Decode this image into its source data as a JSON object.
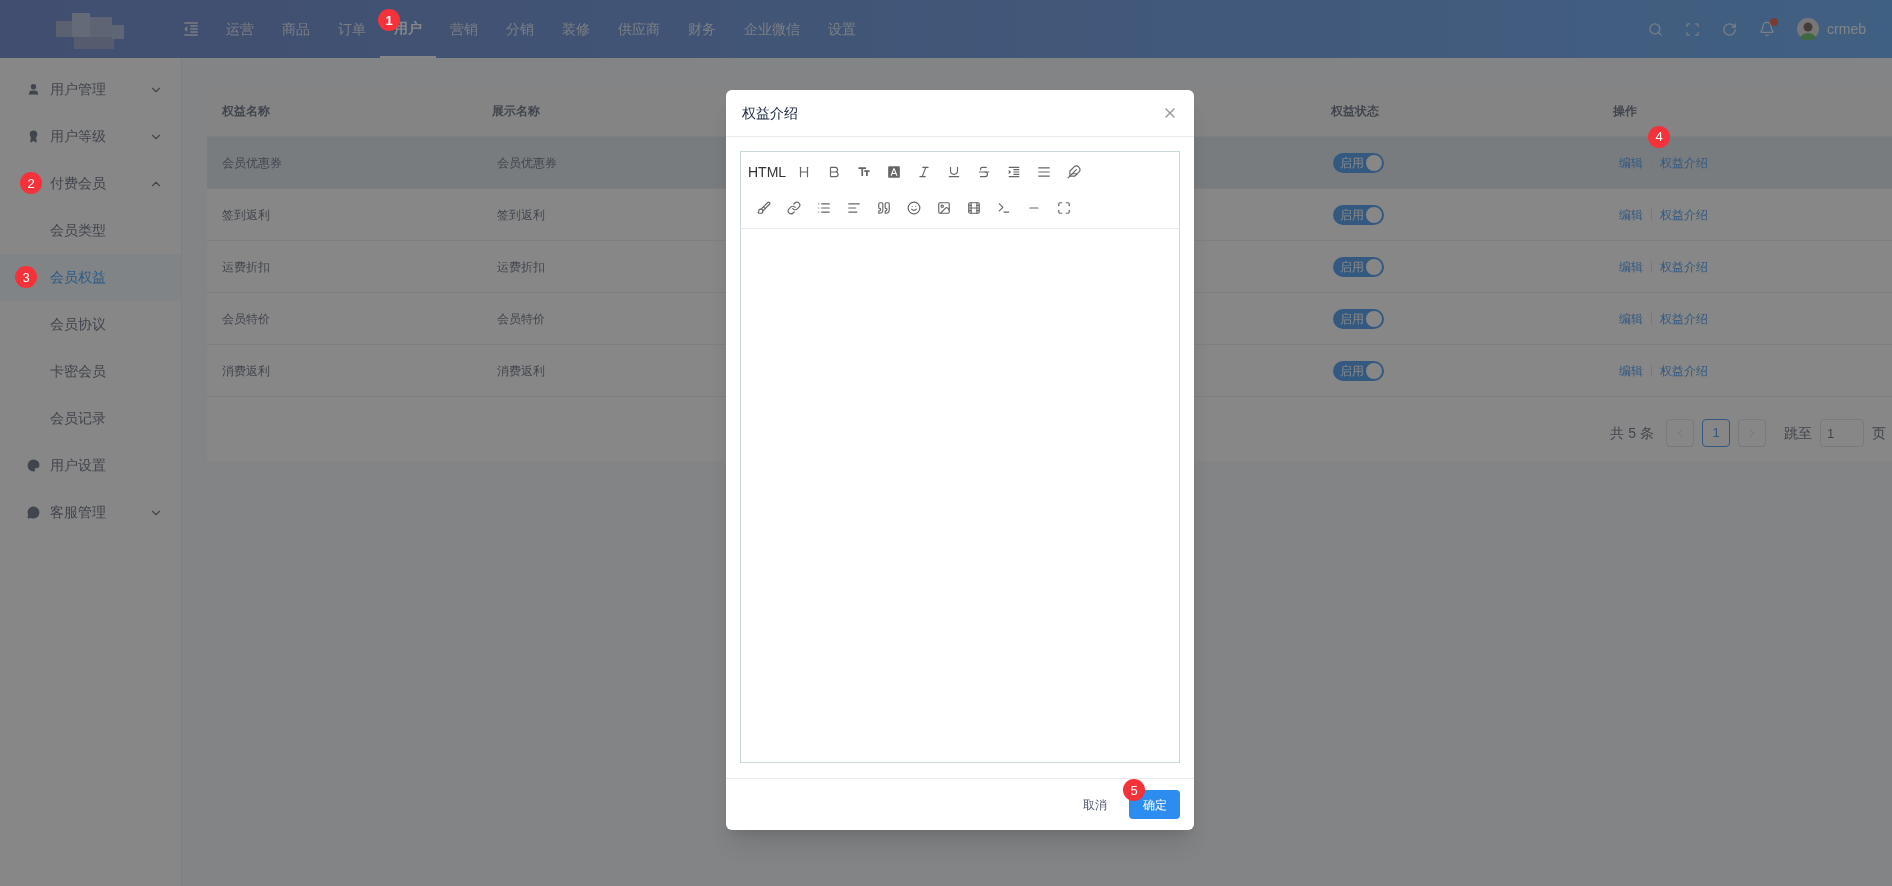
{
  "header": {
    "nav": [
      {
        "label": "运营",
        "selected": false
      },
      {
        "label": "商品",
        "selected": false
      },
      {
        "label": "订单",
        "selected": false
      },
      {
        "label": "用户",
        "selected": true,
        "annotation": "1"
      },
      {
        "label": "营销",
        "selected": false
      },
      {
        "label": "分销",
        "selected": false
      },
      {
        "label": "装修",
        "selected": false
      },
      {
        "label": "供应商",
        "selected": false
      },
      {
        "label": "财务",
        "selected": false
      },
      {
        "label": "企业微信",
        "selected": false
      },
      {
        "label": "设置",
        "selected": false
      }
    ],
    "user": "crmeb",
    "notification_dot": true
  },
  "sidebar": {
    "items": [
      {
        "label": "用户管理",
        "expanded": false,
        "selected": false
      },
      {
        "label": "用户等级",
        "expanded": false,
        "selected": false
      },
      {
        "label": "付费会员",
        "expanded": true,
        "selected": false,
        "annotation": "2",
        "children": [
          {
            "label": "会员类型",
            "selected": false
          },
          {
            "label": "会员权益",
            "selected": true,
            "annotation": "3"
          },
          {
            "label": "会员协议",
            "selected": false
          },
          {
            "label": "卡密会员",
            "selected": false
          },
          {
            "label": "会员记录",
            "selected": false
          }
        ]
      },
      {
        "label": "用户设置",
        "selected": false
      },
      {
        "label": "客服管理",
        "expanded": false,
        "selected": false
      }
    ]
  },
  "table": {
    "columns": [
      "权益名称",
      "展示名称",
      "权益状态",
      "操作"
    ],
    "rows": [
      {
        "name": "会员优惠券",
        "display_name": "会员优惠券",
        "status": "启用",
        "on": true,
        "highlighted": true,
        "actions": [
          "编辑",
          "权益介绍"
        ],
        "annotation": "4"
      },
      {
        "name": "签到返利",
        "display_name": "签到返利",
        "status": "启用",
        "on": true,
        "highlighted": false,
        "actions": [
          "编辑",
          "权益介绍"
        ]
      },
      {
        "name": "运费折扣",
        "display_name": "运费折扣",
        "status": "启用",
        "on": true,
        "highlighted": false,
        "actions": [
          "编辑",
          "权益介绍"
        ]
      },
      {
        "name": "会员特价",
        "display_name": "会员特价",
        "status": "启用",
        "on": true,
        "highlighted": false,
        "actions": [
          "编辑",
          "权益介绍"
        ]
      },
      {
        "name": "消费返利",
        "display_name": "消费返利",
        "status": "启用",
        "on": true,
        "highlighted": false,
        "actions": [
          "编辑",
          "权益介绍"
        ]
      }
    ]
  },
  "pagination": {
    "total": "共 5 条",
    "pages": [
      {
        "label": "1",
        "selected": true
      }
    ],
    "jump_label": "跳至",
    "jump_value": "1",
    "page_unit": "页"
  },
  "modal": {
    "title": "权益介绍",
    "editor": {
      "html_label": "HTML"
    },
    "cancel": "取消",
    "confirm": "确定",
    "confirm_annotation": "5"
  }
}
